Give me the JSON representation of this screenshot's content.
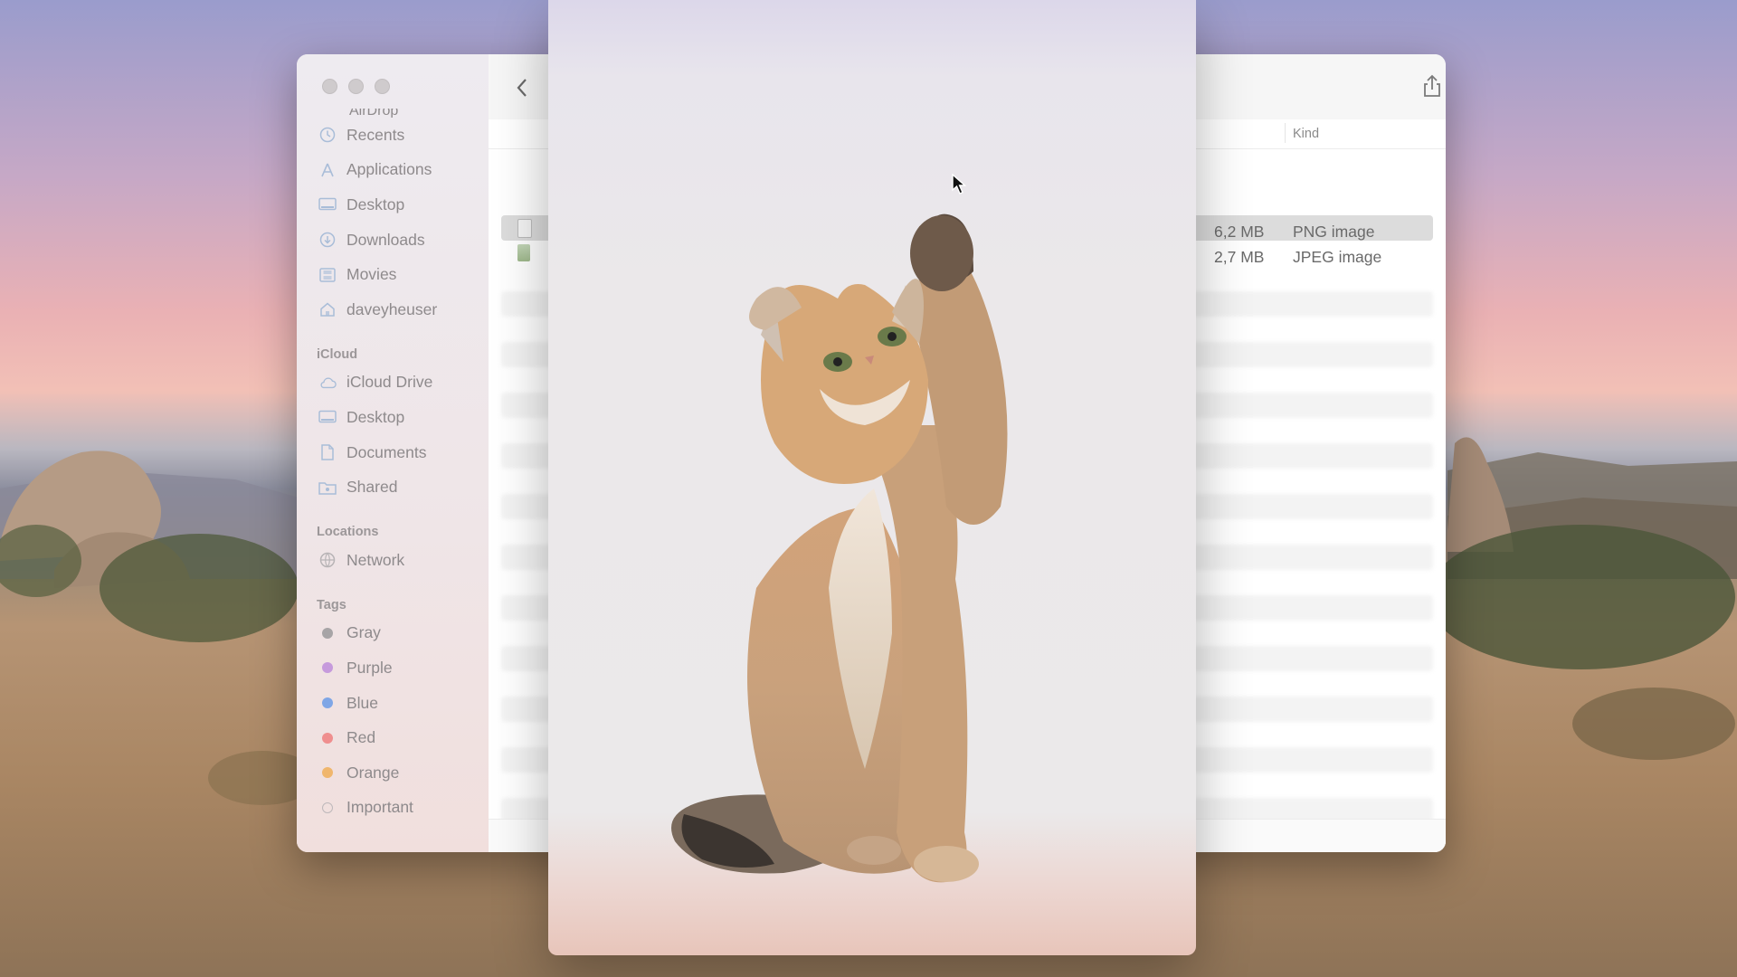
{
  "finder": {
    "sidebar": {
      "truncated_item": "AirDrop",
      "favorites": [
        {
          "label": "Recents",
          "icon": "clock-icon"
        },
        {
          "label": "Applications",
          "icon": "applications-icon"
        },
        {
          "label": "Desktop",
          "icon": "desktop-icon"
        },
        {
          "label": "Downloads",
          "icon": "download-icon"
        },
        {
          "label": "Movies",
          "icon": "film-icon"
        },
        {
          "label": "daveyheuser",
          "icon": "home-icon"
        }
      ],
      "icloud_heading": "iCloud",
      "icloud": [
        {
          "label": "iCloud Drive",
          "icon": "cloud-icon"
        },
        {
          "label": "Desktop",
          "icon": "desktop-icon"
        },
        {
          "label": "Documents",
          "icon": "document-icon"
        },
        {
          "label": "Shared",
          "icon": "shared-folder-icon"
        }
      ],
      "locations_heading": "Locations",
      "locations": [
        {
          "label": "Network",
          "icon": "network-icon"
        }
      ],
      "tags_heading": "Tags",
      "tags": [
        {
          "label": "Gray",
          "color": "#a7a4a6"
        },
        {
          "label": "Purple",
          "color": "#c69adc"
        },
        {
          "label": "Blue",
          "color": "#7fa6e6"
        },
        {
          "label": "Red",
          "color": "#ef8e8e"
        },
        {
          "label": "Orange",
          "color": "#f0b66d"
        },
        {
          "label": "Important",
          "color": "none"
        }
      ]
    },
    "toolbar": {
      "back_icon": "chevron-left-icon",
      "share_icon": "share-icon",
      "tag_icon": "tag-icon",
      "more_icon": "ellipsis-circle-icon",
      "search_icon": "magnifier-icon"
    },
    "columns": {
      "kind": "Kind"
    },
    "files": [
      {
        "size": "6,2 MB",
        "kind": "PNG image",
        "selected": true
      },
      {
        "size": "2,7 MB",
        "kind": "JPEG image",
        "selected": false
      }
    ]
  },
  "colors": {
    "sidebar_icon": "#a9bdd8",
    "selection": "#dcdcdc"
  }
}
